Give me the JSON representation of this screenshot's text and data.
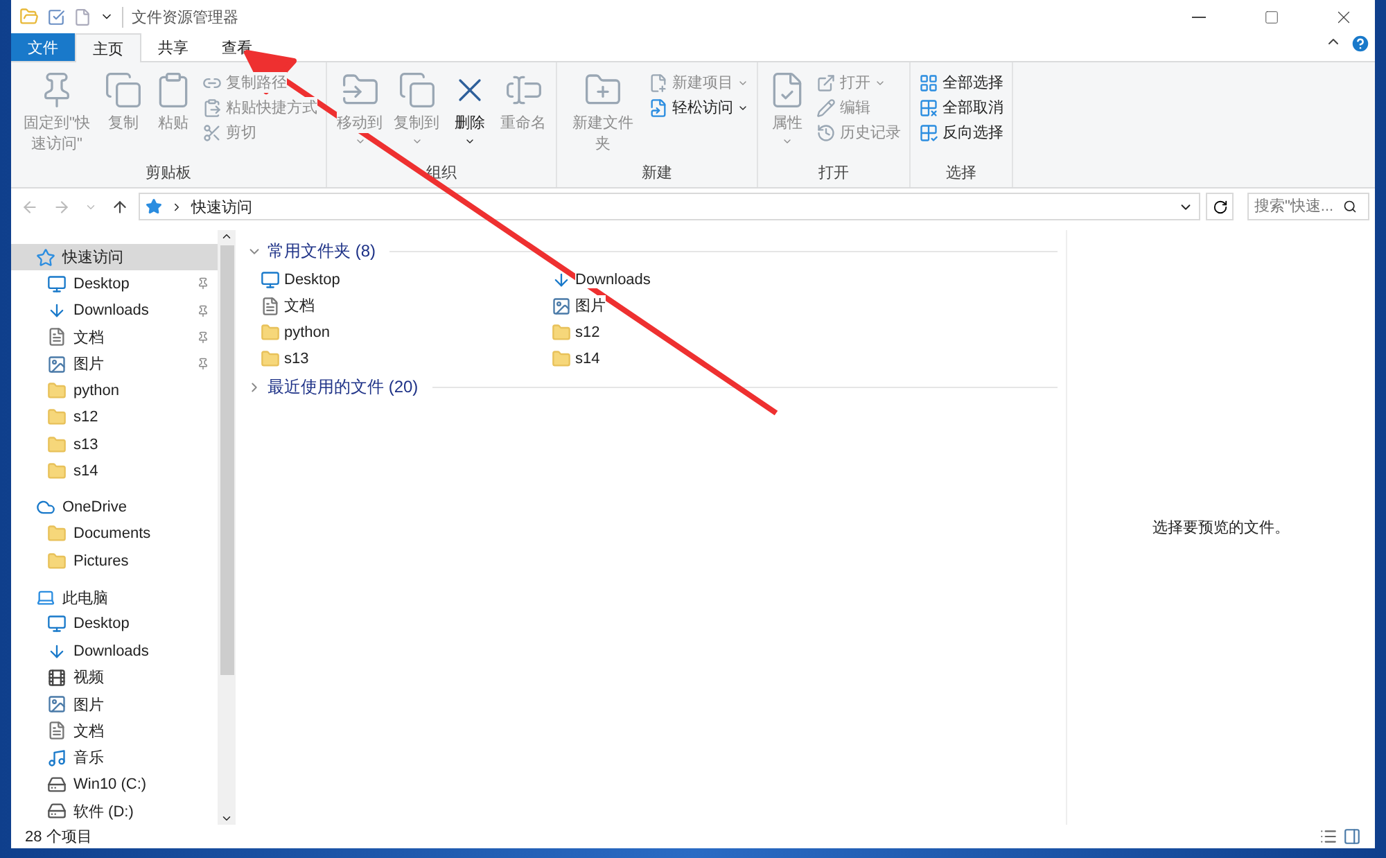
{
  "window": {
    "title": "文件资源管理器"
  },
  "tabs": [
    {
      "label": "文件",
      "kind": "file",
      "selected": false
    },
    {
      "label": "主页",
      "kind": "tab",
      "selected": true
    },
    {
      "label": "共享",
      "kind": "tab",
      "selected": false
    },
    {
      "label": "查看",
      "kind": "tab",
      "selected": false
    }
  ],
  "ribbon": {
    "groups": [
      {
        "label": "剪贴板",
        "items": [
          {
            "kind": "large",
            "label": "固定到\"快速访问\"",
            "disabled": true,
            "dropdown": false
          },
          {
            "kind": "large",
            "label": "复制",
            "disabled": true,
            "dropdown": false
          },
          {
            "kind": "large",
            "label": "粘贴",
            "disabled": true,
            "dropdown": false
          },
          {
            "kind": "small",
            "label": "复制路径",
            "disabled": true,
            "dropdown": false
          },
          {
            "kind": "small",
            "label": "粘贴快捷方式",
            "disabled": true,
            "dropdown": false
          },
          {
            "kind": "small",
            "label": "剪切",
            "disabled": true,
            "dropdown": false
          }
        ]
      },
      {
        "label": "组织",
        "items": [
          {
            "kind": "large",
            "label": "移动到",
            "disabled": true,
            "dropdown": true
          },
          {
            "kind": "large",
            "label": "复制到",
            "disabled": true,
            "dropdown": true
          },
          {
            "kind": "large",
            "label": "删除",
            "disabled": false,
            "dropdown": true
          },
          {
            "kind": "large",
            "label": "重命名",
            "disabled": true,
            "dropdown": false
          }
        ]
      },
      {
        "label": "新建",
        "items": [
          {
            "kind": "large",
            "label": "新建文件夹",
            "disabled": true,
            "dropdown": false
          },
          {
            "kind": "small",
            "label": "新建项目",
            "disabled": true,
            "dropdown": true
          },
          {
            "kind": "small",
            "label": "轻松访问",
            "disabled": false,
            "dropdown": true
          }
        ]
      },
      {
        "label": "打开",
        "items": [
          {
            "kind": "large",
            "label": "属性",
            "disabled": true,
            "dropdown": true
          },
          {
            "kind": "small",
            "label": "打开",
            "disabled": true,
            "dropdown": true
          },
          {
            "kind": "small",
            "label": "编辑",
            "disabled": true,
            "dropdown": false
          },
          {
            "kind": "small",
            "label": "历史记录",
            "disabled": true,
            "dropdown": false
          }
        ]
      },
      {
        "label": "选择",
        "items": [
          {
            "kind": "small",
            "label": "全部选择",
            "disabled": false,
            "dropdown": false
          },
          {
            "kind": "small",
            "label": "全部取消",
            "disabled": false,
            "dropdown": false
          },
          {
            "kind": "small",
            "label": "反向选择",
            "disabled": false,
            "dropdown": false
          }
        ]
      }
    ]
  },
  "address": {
    "location": "快速访问"
  },
  "search": {
    "placeholder": "搜索\"快速..."
  },
  "navigation": [
    {
      "label": "快速访问",
      "kind": "star",
      "selected": true,
      "children": [
        {
          "label": "Desktop",
          "kind": "desktop",
          "pinned": true,
          "selected": false
        },
        {
          "label": "Downloads",
          "kind": "download",
          "pinned": true,
          "selected": false
        },
        {
          "label": "文档",
          "kind": "document",
          "pinned": true,
          "selected": false
        },
        {
          "label": "图片",
          "kind": "picture",
          "pinned": true,
          "selected": false
        },
        {
          "label": "python",
          "kind": "folder",
          "pinned": false,
          "selected": false
        },
        {
          "label": "s12",
          "kind": "folder",
          "pinned": false,
          "selected": false
        },
        {
          "label": "s13",
          "kind": "folder",
          "pinned": false,
          "selected": false
        },
        {
          "label": "s14",
          "kind": "folder",
          "pinned": false,
          "selected": false
        }
      ]
    },
    {
      "label": "OneDrive",
      "kind": "cloud",
      "selected": false,
      "children": [
        {
          "label": "Documents",
          "kind": "folder",
          "pinned": false,
          "selected": false
        },
        {
          "label": "Pictures",
          "kind": "folder",
          "pinned": false,
          "selected": false
        }
      ]
    },
    {
      "label": "此电脑",
      "kind": "computer",
      "selected": false,
      "children": [
        {
          "label": "Desktop",
          "kind": "desktop",
          "pinned": false,
          "selected": false
        },
        {
          "label": "Downloads",
          "kind": "download",
          "pinned": false,
          "selected": false
        },
        {
          "label": "视频",
          "kind": "video",
          "pinned": false,
          "selected": false
        },
        {
          "label": "图片",
          "kind": "picture",
          "pinned": false,
          "selected": false
        },
        {
          "label": "文档",
          "kind": "document",
          "pinned": false,
          "selected": false
        },
        {
          "label": "音乐",
          "kind": "music",
          "pinned": false,
          "selected": false
        },
        {
          "label": "Win10 (C:)",
          "kind": "system-drive",
          "pinned": false,
          "selected": false
        },
        {
          "label": "软件 (D:)",
          "kind": "drive",
          "pinned": false,
          "selected": false
        }
      ]
    }
  ],
  "sections": [
    {
      "title": "常用文件夹 (8)",
      "expanded": true,
      "items": [
        {
          "label": "Desktop",
          "kind": "desktop"
        },
        {
          "label": "Downloads",
          "kind": "download"
        },
        {
          "label": "文档",
          "kind": "document"
        },
        {
          "label": "图片",
          "kind": "picture"
        },
        {
          "label": "python",
          "kind": "folder"
        },
        {
          "label": "s12",
          "kind": "folder"
        },
        {
          "label": "s13",
          "kind": "folder"
        },
        {
          "label": "s14",
          "kind": "folder"
        }
      ]
    },
    {
      "title": "最近使用的文件 (20)",
      "expanded": false
    }
  ],
  "preview": {
    "message": "选择要预览的文件。"
  },
  "status_bar": {
    "count": "28 个项目"
  }
}
